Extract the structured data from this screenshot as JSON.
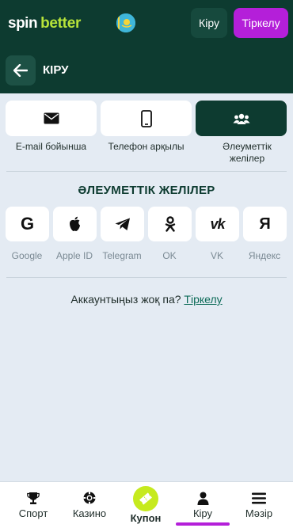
{
  "header": {
    "logo_spin": "spin",
    "logo_better": "better",
    "flag_icon": "kazakhstan-flag-icon",
    "login_label": "Кіру",
    "register_label": "Тіркелу"
  },
  "subheader": {
    "back_icon": "arrow-left-icon",
    "title": "КІРУ"
  },
  "login_tabs": [
    {
      "label": "E-mail бойынша",
      "icon": "envelope-icon",
      "active": false
    },
    {
      "label": "Телефон арқылы",
      "icon": "phone-icon",
      "active": false
    },
    {
      "label": "Әлеуметтік желілер",
      "icon": "users-icon",
      "active": true
    }
  ],
  "social_section": {
    "title": "ӘЛЕУМЕТТІК ЖЕЛІЛЕР",
    "providers": [
      {
        "label": "Google",
        "icon": "google-icon",
        "glyph": "G"
      },
      {
        "label": "Apple ID",
        "icon": "apple-icon",
        "glyph": ""
      },
      {
        "label": "Telegram",
        "icon": "telegram-icon",
        "glyph": ""
      },
      {
        "label": "OK",
        "icon": "odnoklassniki-icon",
        "glyph": ""
      },
      {
        "label": "VK",
        "icon": "vk-icon",
        "glyph": "vk"
      },
      {
        "label": "Яндекс",
        "icon": "yandex-icon",
        "glyph": "Я"
      }
    ]
  },
  "signup": {
    "prompt": "Аккаунтыңыз жоқ па?",
    "link": "Тіркелу"
  },
  "bottom_nav": {
    "items": [
      {
        "label": "Спорт",
        "icon": "trophy-icon"
      },
      {
        "label": "Казино",
        "icon": "casino-chip-icon"
      },
      {
        "label": "Купон",
        "icon": "coupon-ticket-icon"
      },
      {
        "label": "Кіру",
        "icon": "user-icon",
        "active": true
      },
      {
        "label": "Мәзір",
        "icon": "menu-icon"
      }
    ]
  },
  "colors": {
    "header_bg": "#0d3b30",
    "accent_purple": "#b41fd9",
    "accent_lime": "#c6ea1e",
    "page_bg": "#e4ebf3"
  }
}
